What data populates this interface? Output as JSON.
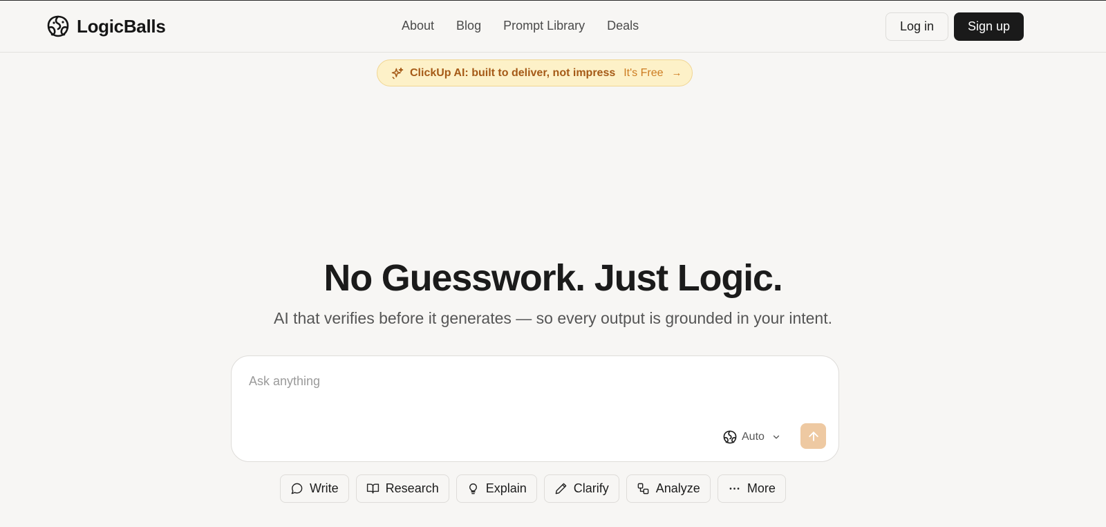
{
  "brand": {
    "name": "LogicBalls",
    "logo_icon": "logicballs-brain-icon"
  },
  "nav": {
    "items": [
      {
        "label": "About"
      },
      {
        "label": "Blog"
      },
      {
        "label": "Prompt Library"
      },
      {
        "label": "Deals"
      }
    ]
  },
  "auth": {
    "login_label": "Log in",
    "signup_label": "Sign up"
  },
  "promo": {
    "icon": "sparkles-icon",
    "text": "ClickUp AI: built to deliver, not impress",
    "cta": "It's Free",
    "cta_icon": "arrow-right-icon"
  },
  "hero": {
    "title": "No Guesswork. Just Logic.",
    "subtitle": "AI that verifies before it generates — so every output is grounded in your intent."
  },
  "composer": {
    "placeholder": "Ask anything",
    "value": "",
    "model_label": "Auto",
    "send_icon": "arrow-up-icon"
  },
  "chips": [
    {
      "label": "Write",
      "icon": "message-circle-icon"
    },
    {
      "label": "Research",
      "icon": "book-open-icon"
    },
    {
      "label": "Explain",
      "icon": "lightbulb-icon"
    },
    {
      "label": "Clarify",
      "icon": "pencil-icon"
    },
    {
      "label": "Analyze",
      "icon": "shapes-icon"
    },
    {
      "label": "More",
      "icon": "ellipsis-icon"
    }
  ],
  "colors": {
    "background": "#f7f6f4",
    "primary_button": "#1a1a1a",
    "promo_bg": "#fdf1c8",
    "promo_text": "#a55a17",
    "promo_cta": "#cc7b20",
    "send_button": "#eec9a2"
  }
}
